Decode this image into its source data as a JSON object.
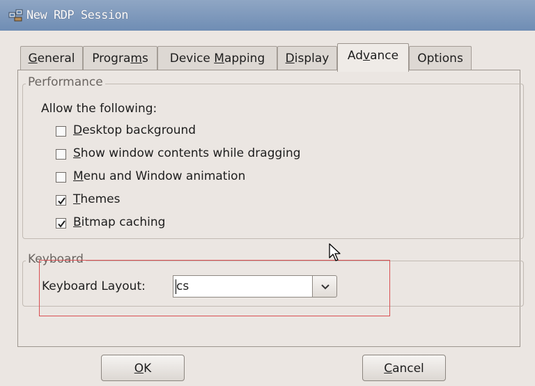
{
  "window": {
    "title": "New RDP Session",
    "icon": "network-computers-icon"
  },
  "tabs": [
    {
      "pre": "",
      "mn": "G",
      "post": "eneral",
      "active": false
    },
    {
      "pre": "Progra",
      "mn": "m",
      "post": "s",
      "active": false
    },
    {
      "pre": "Device ",
      "mn": "M",
      "post": "apping",
      "active": false
    },
    {
      "pre": "",
      "mn": "D",
      "post": "isplay",
      "active": false
    },
    {
      "pre": "Ad",
      "mn": "v",
      "post": "ance",
      "active": true
    },
    {
      "pre": "Options",
      "mn": "",
      "post": "",
      "active": false
    }
  ],
  "performance": {
    "legend": "Performance",
    "intro": "Allow the following:",
    "options": [
      {
        "mn": "D",
        "rest": "esktop background",
        "checked": false
      },
      {
        "mn": "S",
        "rest": "how window contents while dragging",
        "checked": false
      },
      {
        "mn": "M",
        "rest": "enu and Window animation",
        "checked": false
      },
      {
        "mn": "T",
        "rest": "hemes",
        "checked": true
      },
      {
        "mn": "B",
        "rest": "itmap caching",
        "checked": true
      }
    ]
  },
  "keyboard": {
    "legend": "Keyboard",
    "layout_label": "Keyboard Layout:",
    "layout_value": "cs"
  },
  "buttons": {
    "ok": {
      "mn": "O",
      "rest": "K"
    },
    "cancel": {
      "mn": "C",
      "rest": "ancel"
    }
  },
  "colors": {
    "titlebar": "#7b98bd",
    "highlight": "#d94f52",
    "dialog_bg": "#ebe6e2"
  }
}
